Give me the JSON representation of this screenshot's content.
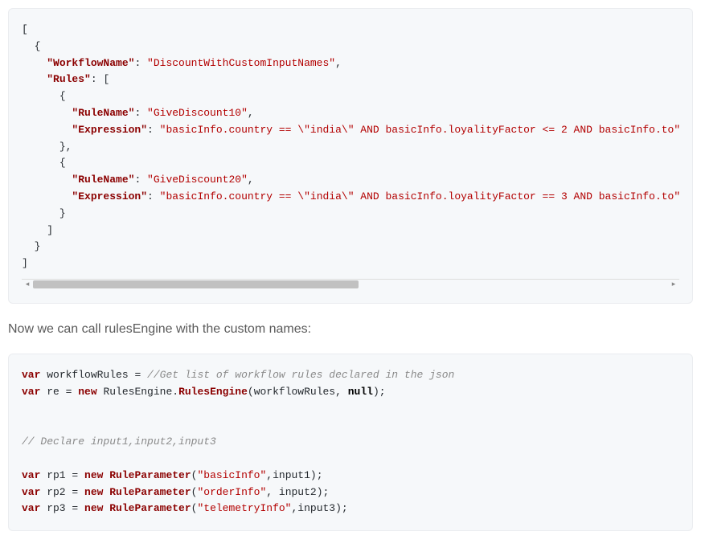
{
  "json_block": {
    "lines": [
      {
        "indent": 0,
        "text": "["
      },
      {
        "indent": 1,
        "text": "{"
      },
      {
        "indent": 2,
        "key": "WorkflowName",
        "value_string": "DiscountWithCustomInputNames",
        "trailing": ","
      },
      {
        "indent": 2,
        "key": "Rules",
        "after_colon": "["
      },
      {
        "indent": 3,
        "text": "{"
      },
      {
        "indent": 4,
        "key": "RuleName",
        "value_string": "GiveDiscount10",
        "trailing": ","
      },
      {
        "indent": 4,
        "key": "Expression",
        "value_string": "basicInfo.country == \\\"india\\\" AND basicInfo.loyalityFactor <= 2 AND basicInfo.to"
      },
      {
        "indent": 3,
        "text": "},"
      },
      {
        "indent": 3,
        "text": "{"
      },
      {
        "indent": 4,
        "key": "RuleName",
        "value_string": "GiveDiscount20",
        "trailing": ","
      },
      {
        "indent": 4,
        "key": "Expression",
        "value_string": "basicInfo.country == \\\"india\\\" AND basicInfo.loyalityFactor == 3 AND basicInfo.to"
      },
      {
        "indent": 3,
        "text": "}"
      },
      {
        "indent": 2,
        "text": "]"
      },
      {
        "indent": 1,
        "text": "}"
      },
      {
        "indent": 0,
        "text": "]"
      }
    ]
  },
  "prose": "Now we can call rulesEngine with the custom names:",
  "csharp_block": {
    "line1_var": "var",
    "line1_name": "workflowRules",
    "line1_eq": " = ",
    "line1_comment": "//Get list of workflow rules declared in the json",
    "line2_var": "var",
    "line2_name": "re",
    "line2_eq": " = ",
    "line2_new": "new",
    "line2_ns": " RulesEngine.",
    "line2_class": "RulesEngine",
    "line2_args_open": "(workflowRules, ",
    "line2_null": "null",
    "line2_args_close": ");",
    "comment_declare": "// Declare input1,input2,input3",
    "rp1_var": "var",
    "rp1_name": " rp1 = ",
    "rp1_new": "new",
    "rp1_class": "RuleParameter",
    "rp1_open": "(",
    "rp1_str": "\"basicInfo\"",
    "rp1_rest": ",input1);",
    "rp2_var": "var",
    "rp2_name": " rp2 = ",
    "rp2_new": "new",
    "rp2_class": "RuleParameter",
    "rp2_open": "(",
    "rp2_str": "\"orderInfo\"",
    "rp2_rest": ", input2);",
    "rp3_var": "var",
    "rp3_name": " rp3 = ",
    "rp3_new": "new",
    "rp3_class": "RuleParameter",
    "rp3_open": "(",
    "rp3_str": "\"telemetryInfo\"",
    "rp3_rest": ",input3);"
  }
}
